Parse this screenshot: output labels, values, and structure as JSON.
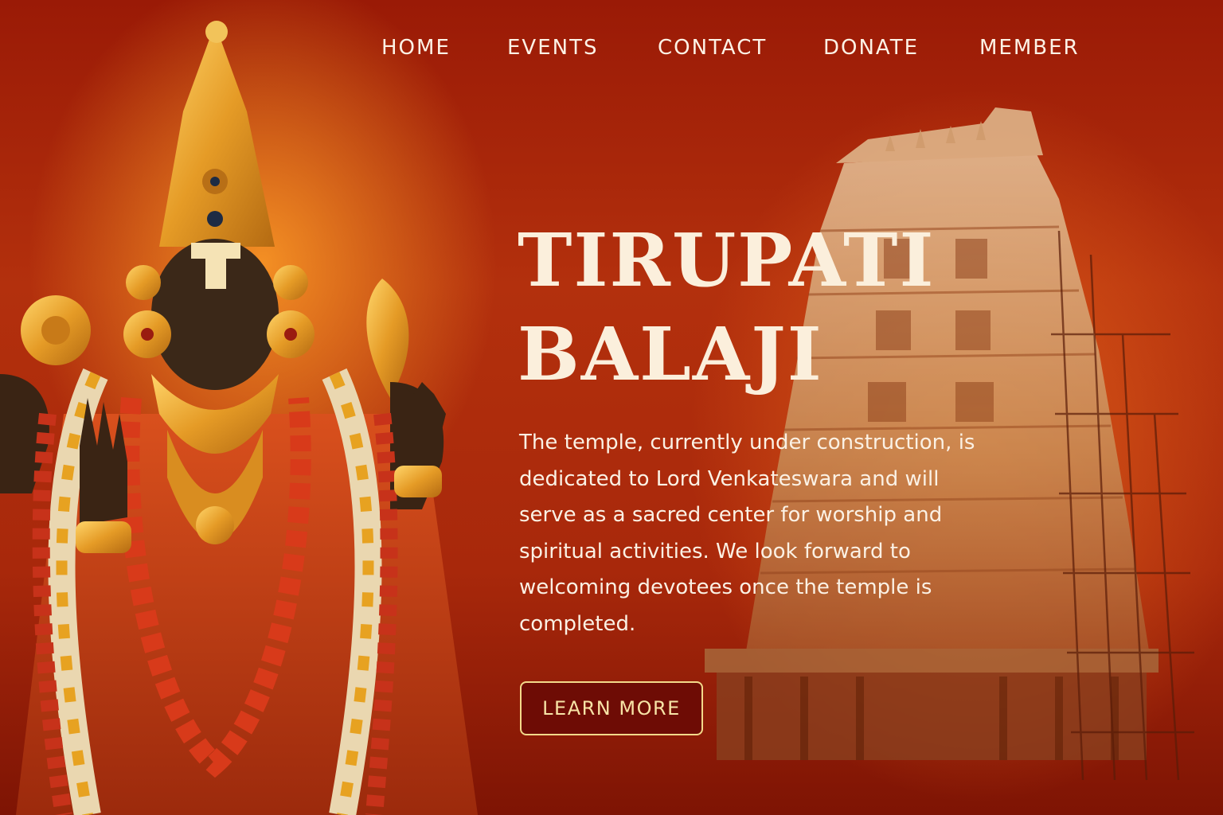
{
  "nav": {
    "items": [
      {
        "label": "HOME"
      },
      {
        "label": "EVENTS"
      },
      {
        "label": "CONTACT"
      },
      {
        "label": "DONATE"
      },
      {
        "label": "MEMBER"
      }
    ]
  },
  "hero": {
    "title_line1": "TIRUPATI",
    "title_line2": "BALAJI",
    "description": "The temple, currently under construction, is dedicated to Lord Venkateswara and will serve as a sacred center for worship and spiritual activities. We look forward to welcoming devotees once the temple is completed.",
    "button_label": "LEARN MORE"
  },
  "images": {
    "deity": "lord-venkateswara-deity-image",
    "temple": "temple-gopuram-under-construction-image"
  },
  "colors": {
    "background": "#a8280b",
    "text": "#fbf1e4",
    "gold": "#e5a32f",
    "button_border": "#f3d98a"
  }
}
